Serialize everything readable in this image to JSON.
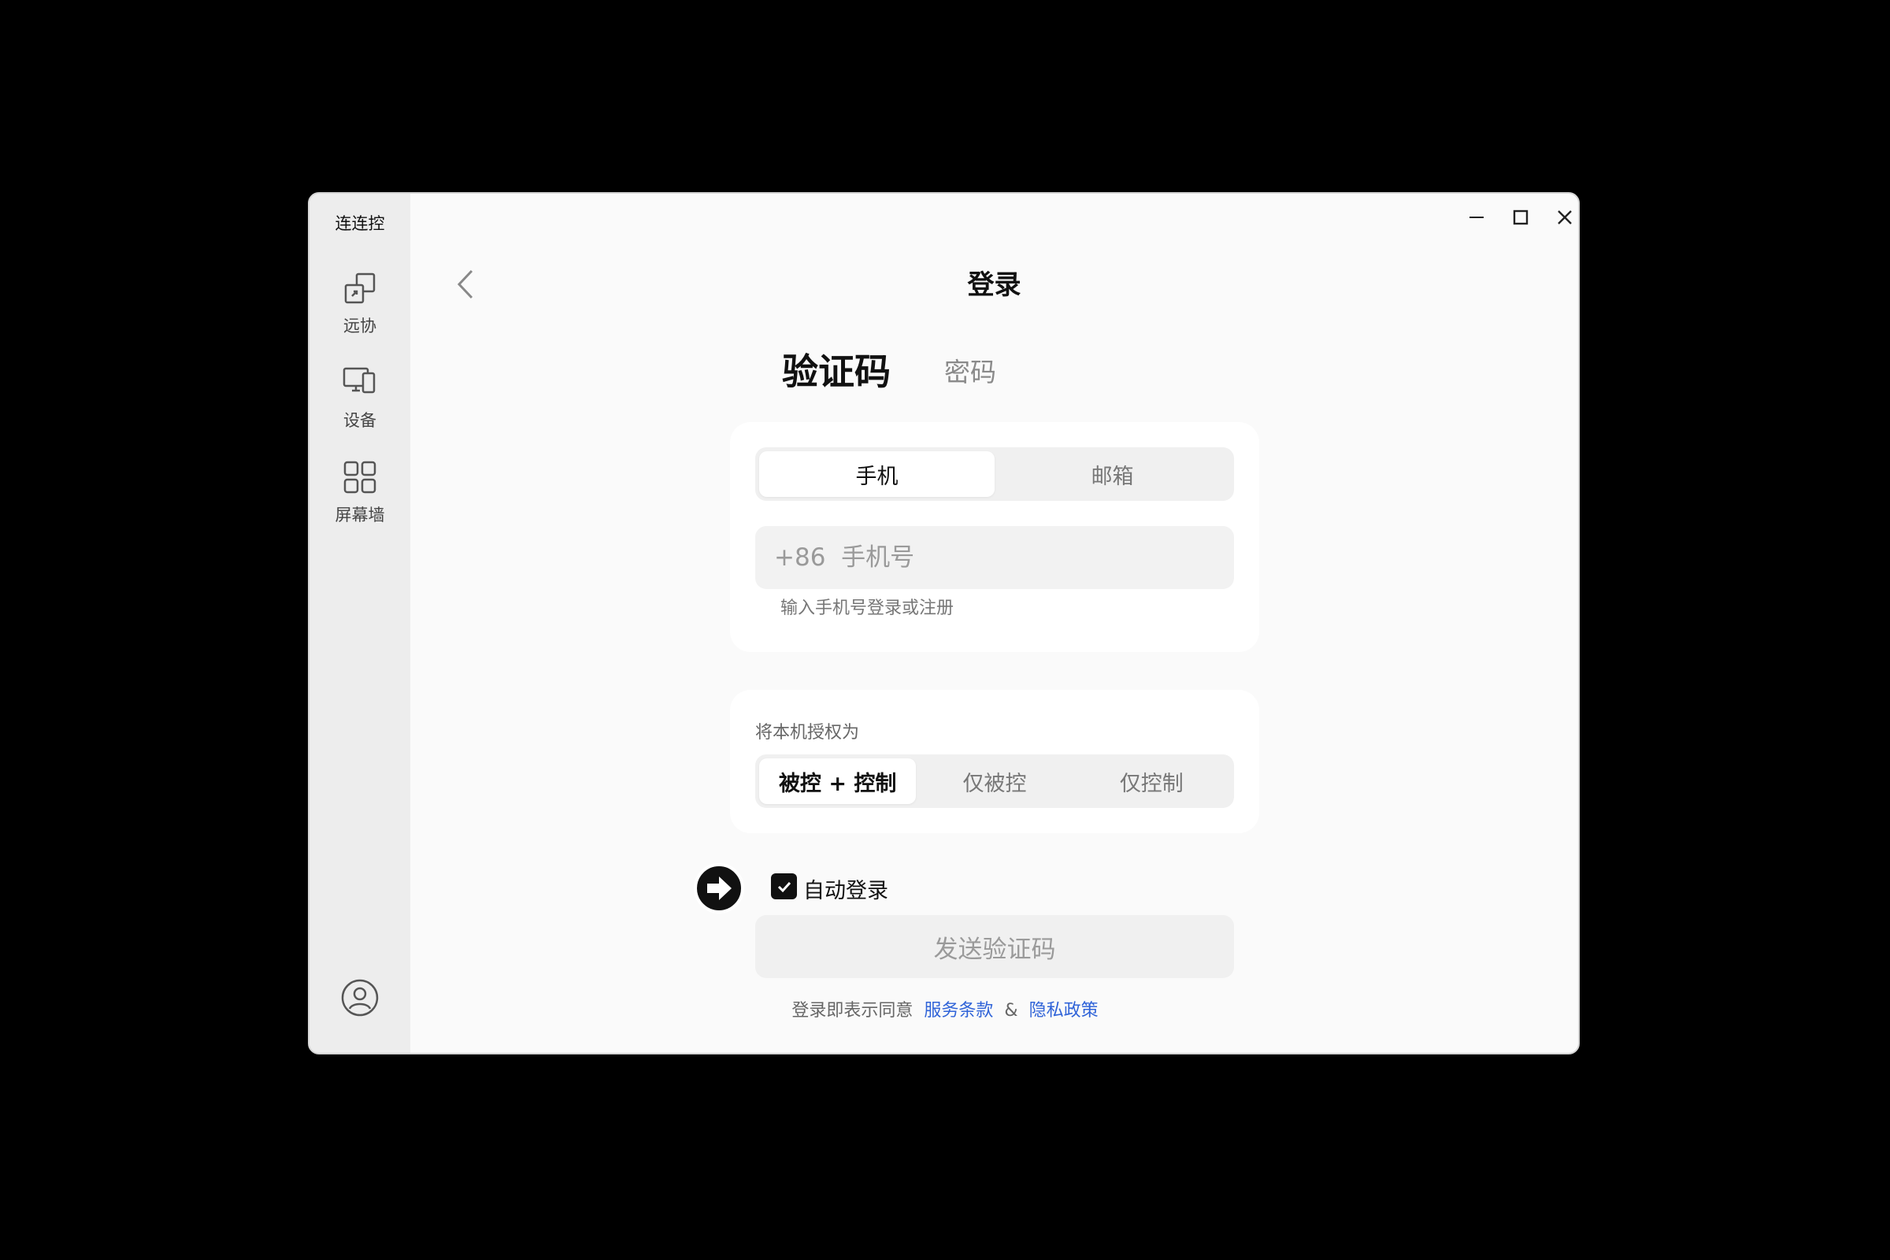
{
  "app": {
    "title": "连连控"
  },
  "sidebar": {
    "items": [
      {
        "label": "远协",
        "icon": "remote-copy-icon"
      },
      {
        "label": "设备",
        "icon": "devices-icon"
      },
      {
        "label": "屏幕墙",
        "icon": "grid-icon"
      }
    ],
    "avatar_icon": "user-avatar-icon"
  },
  "window_controls": {
    "minimize": "minimize-icon",
    "maximize": "maximize-icon",
    "close": "close-icon"
  },
  "page": {
    "title": "登录"
  },
  "login_tabs": {
    "active": "验证码",
    "inactive": "密码"
  },
  "contact_toggle": {
    "phone": "手机",
    "email": "邮箱",
    "selected": "手机"
  },
  "phone_input": {
    "placeholder": "+86  手机号",
    "value": ""
  },
  "phone_hint": "输入手机号登录或注册",
  "auth": {
    "label": "将本机授权为",
    "options": [
      "被控 + 控制",
      "仅被控",
      "仅控制"
    ],
    "selected": "被控 + 控制"
  },
  "auto_login": {
    "label": "自动登录",
    "checked": true
  },
  "send_button": {
    "label": "发送验证码"
  },
  "legal": {
    "prefix": "登录即表示同意",
    "terms": "服务条款",
    "amp": "&",
    "privacy": "隐私政策"
  },
  "colors": {
    "link": "#2f63d8",
    "primary": "#111111",
    "window_bg": "#fafafa",
    "sidebar_bg": "#ededed"
  }
}
